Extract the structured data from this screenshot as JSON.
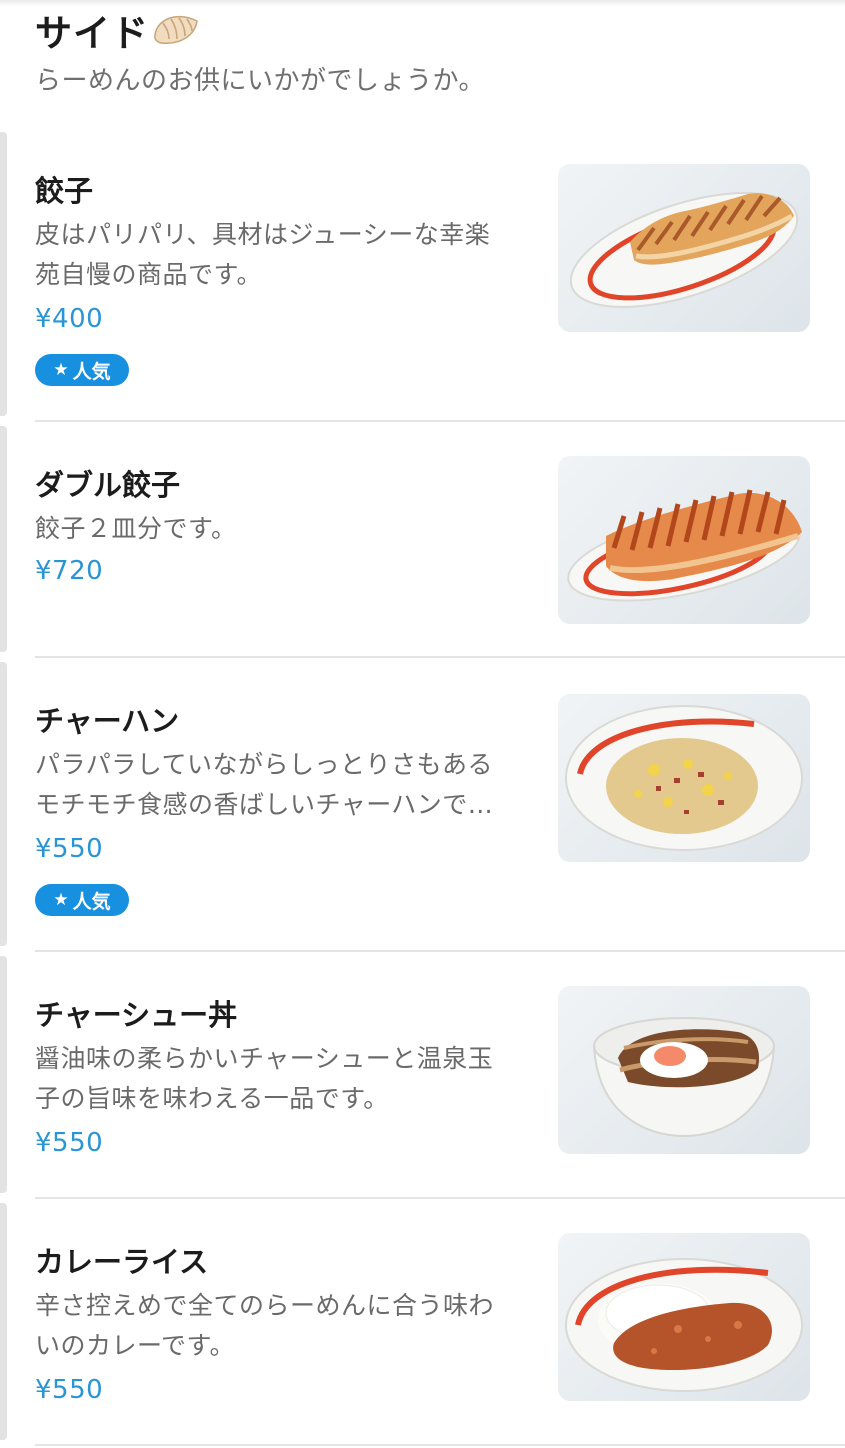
{
  "section": {
    "title": "サイド",
    "icon": "gyoza-icon",
    "subtitle": "らーめんのお供にいかがでしょうか。"
  },
  "badge_label": "★人気",
  "badge_text": "人気",
  "badge_star": "★",
  "colors": {
    "price": "#2a95d4",
    "badge_bg": "#1890e0",
    "plate_rim": "#e0452a"
  },
  "items": [
    {
      "name": "餃子",
      "desc_lines": [
        "皮はパリパリ、具材はジューシーな幸楽",
        "苑自慢の商品です。"
      ],
      "price": "¥400",
      "popular": true,
      "image": "gyoza-plate"
    },
    {
      "name": "ダブル餃子",
      "desc_lines": [
        "餃子２皿分です。"
      ],
      "price": "¥720",
      "popular": false,
      "image": "double-gyoza-plate"
    },
    {
      "name": "チャーハン",
      "desc_lines": [
        "パラパラしていながらしっとりさもある",
        "モチモチ食感の香ばしいチャーハンで…"
      ],
      "price": "¥550",
      "popular": true,
      "image": "fried-rice-plate"
    },
    {
      "name": "チャーシュー丼",
      "desc_lines": [
        "醤油味の柔らかいチャーシューと温泉玉",
        "子の旨味を味わえる一品です。"
      ],
      "price": "¥550",
      "popular": false,
      "image": "chashu-bowl"
    },
    {
      "name": "カレーライス",
      "desc_lines": [
        "辛さ控えめで全てのらーめんに合う味わ",
        "いのカレーです。"
      ],
      "price": "¥550",
      "popular": false,
      "image": "curry-plate"
    }
  ]
}
